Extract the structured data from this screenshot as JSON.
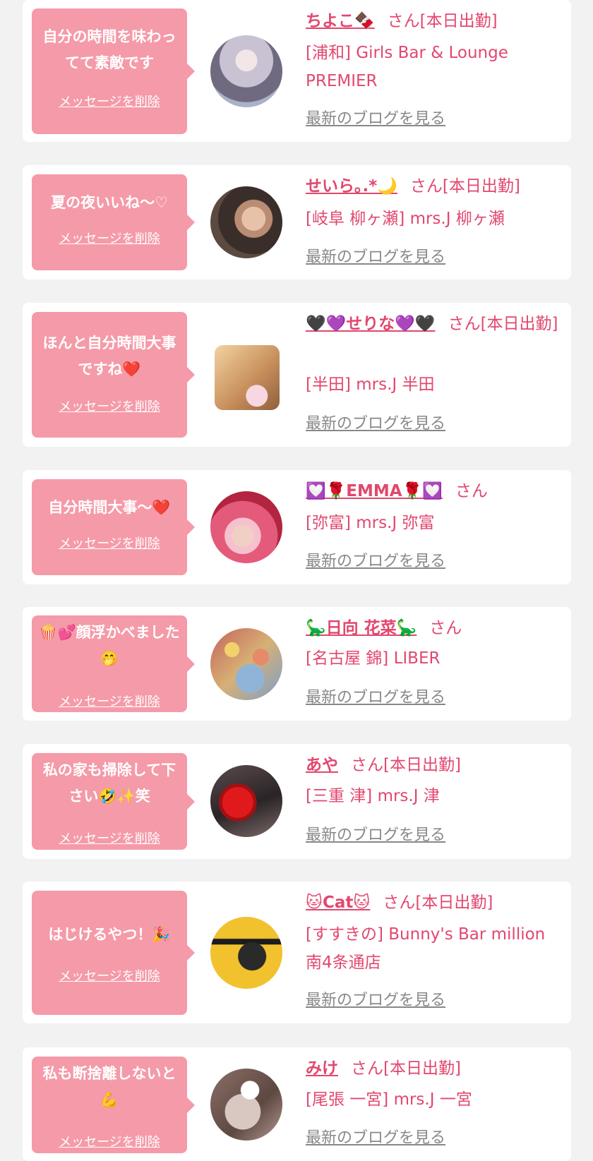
{
  "items": [
    {
      "message": "自分の時間を味わってて素敵です",
      "delete_label": "メッセージを削除",
      "name": "ちよこ🍫",
      "suffix": "さん[本日出勤]",
      "shop": "[浦和] Girls Bar & Lounge PREMIER",
      "blog_label": "最新のブログを見る",
      "avatar_colors": [
        "#c8c2d2",
        "#6f6a80",
        "#a9b2c8"
      ]
    },
    {
      "message": "夏の夜いいね～♡",
      "delete_label": "メッセージを削除",
      "name": "せいら｡.*🌙",
      "suffix": "さん[本日出勤]",
      "shop": "[岐阜 柳ヶ瀬] mrs.J 柳ヶ瀬",
      "blog_label": "最新のブログを見る",
      "avatar_colors": [
        "#3a2e2a",
        "#d9b9a3",
        "#5b4a40"
      ]
    },
    {
      "message": "ほんと自分時間大事ですね❤️",
      "delete_label": "メッセージを削除",
      "name": "🖤💜せりな💜🖤",
      "suffix": "さん[本日出勤]",
      "shop": "[半田] mrs.J 半田",
      "blog_label": "最新のブログを見る",
      "avatar_colors": [
        "#e9c48f",
        "#c9915e",
        "#f7d8e2"
      ]
    },
    {
      "message": "自分時間大事～❤️",
      "delete_label": "メッセージを削除",
      "name": "💟🌹EMMA🌹💟",
      "suffix": "さん",
      "shop": "[弥富] mrs.J 弥富",
      "blog_label": "最新のブログを見る",
      "avatar_colors": [
        "#e45a7a",
        "#f6c1ce",
        "#b2243f"
      ]
    },
    {
      "message": "🍿💕顔浮かべました🤭",
      "delete_label": "メッセージを削除",
      "name": "🦕日向 花菜🦕",
      "suffix": "さん",
      "shop": "[名古屋 錦] LIBER",
      "blog_label": "最新のブログを見る",
      "avatar_colors": [
        "#e58a6a",
        "#8fb4d8",
        "#f2d26a"
      ]
    },
    {
      "message": "私の家も掃除して下さい🤣✨笑",
      "delete_label": "メッセージを削除",
      "name": "あや",
      "suffix": "さん[本日出勤]",
      "shop": "[三重 津] mrs.J 津",
      "blog_label": "最新のブログを見る",
      "avatar_colors": [
        "#2a2426",
        "#d81418",
        "#7d6a6a"
      ]
    },
    {
      "message": "はじけるやつ！🎉",
      "delete_label": "メッセージを削除",
      "name": "🐱Cat🐱",
      "suffix": "さん[本日出勤]",
      "shop": "[すすきの] Bunny's Bar million 南4条通店",
      "blog_label": "最新のブログを見る",
      "avatar_colors": [
        "#f2c12e",
        "#1c1c1c",
        "#e8b024"
      ]
    },
    {
      "message": "私も断捨離しないと💪",
      "delete_label": "メッセージを削除",
      "name": "みけ",
      "suffix": "さん[本日出勤]",
      "shop": "[尾張 一宮] mrs.J 一宮",
      "blog_label": "最新のブログを見る",
      "avatar_colors": [
        "#d9c7c2",
        "#8a6f66",
        "#f4ede9"
      ]
    }
  ]
}
